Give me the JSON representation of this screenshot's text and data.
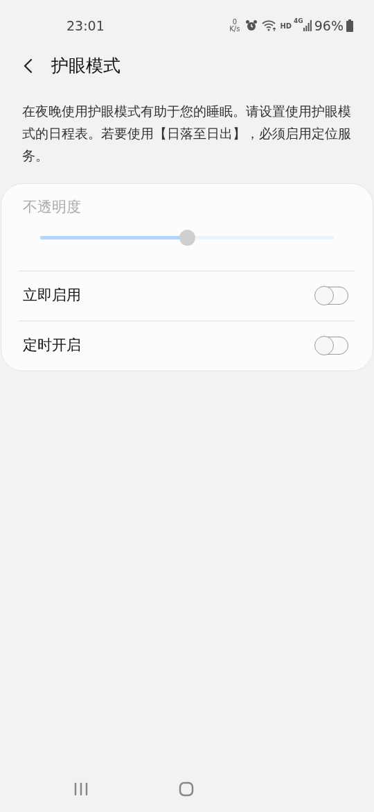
{
  "status_bar": {
    "time": "23:01",
    "net_speed_value": "0",
    "net_speed_unit": "K/s",
    "hd": "HD",
    "network": "4G",
    "battery": "96%"
  },
  "header": {
    "title": "护眼模式"
  },
  "description": "在夜晚使用护眼模式有助于您的睡眠。请设置使用护眼模式的日程表。若要使用【日落至日出】，必须启用定位服务。",
  "opacity": {
    "label": "不透明度",
    "disabled": true,
    "level": 0.5
  },
  "toggles": [
    {
      "label": "立即启用",
      "on": false
    },
    {
      "label": "定时开启",
      "on": false
    }
  ]
}
